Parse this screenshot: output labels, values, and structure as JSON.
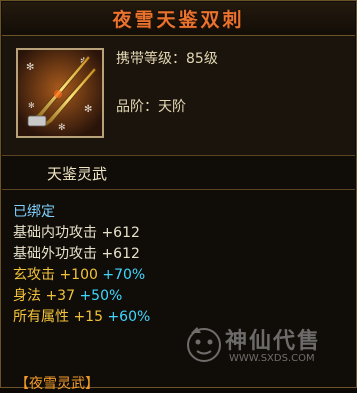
{
  "item": {
    "name": "夜雪天鉴双刺",
    "level_requirement": "携带等级：85级",
    "grade": "品阶：天阶",
    "set_name": "天鉴灵武",
    "binding": "已绑定",
    "stats": [
      {
        "label": "基础内功攻击",
        "base": "+612",
        "bonus": ""
      },
      {
        "label": "基础外功攻击",
        "base": "+612",
        "bonus": ""
      },
      {
        "label": "玄攻击",
        "base": "+100",
        "bonus": "+70%"
      },
      {
        "label": "身法",
        "base": "+37",
        "bonus": "+50%"
      },
      {
        "label": "所有属性",
        "base": "+15",
        "bonus": "+60%"
      }
    ],
    "footer_label": "【夜雪灵武】"
  },
  "watermark": {
    "brand": "神仙代售",
    "url": "WWW.SXDS.COM"
  },
  "colors": {
    "title": "#e8722e",
    "bound": "#7fd0ff",
    "bonus": "#3fd7ff",
    "warm_stat": "#f2c33a"
  },
  "icons": [
    "daggers-icon",
    "snowflake-icon"
  ]
}
